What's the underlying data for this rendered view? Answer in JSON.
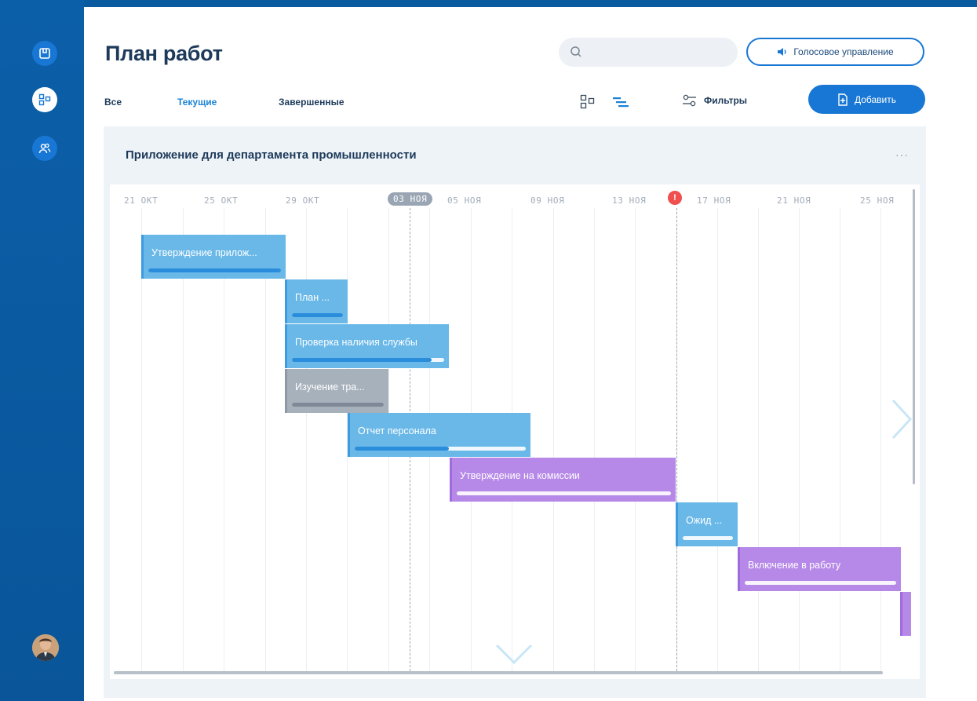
{
  "page": {
    "title": "План работ"
  },
  "search": {
    "placeholder": ""
  },
  "header": {
    "voice_label": "Голосовое управление"
  },
  "tabs": [
    {
      "label": "Все",
      "active": false
    },
    {
      "label": "Текущие",
      "active": true
    },
    {
      "label": "Завершенные",
      "active": false
    }
  ],
  "toolbar": {
    "filters_label": "Фильтры",
    "add_label": "Добавить"
  },
  "project": {
    "title": "Приложение для департамента промышленности",
    "menu": "···"
  },
  "gantt": {
    "dates": [
      "21 ОКТ",
      "25 ОКТ",
      "29 ОКТ",
      "03 НОЯ",
      "05 НОЯ",
      "09 НОЯ",
      "13 НОЯ",
      "17 НОЯ",
      "21 НОЯ",
      "25 НОЯ"
    ],
    "today": "03 НОЯ",
    "alert_mark": "!",
    "tasks": [
      {
        "label": "Утверждение прилож...",
        "color": "blue",
        "progress": 1.0
      },
      {
        "label": "План ...",
        "color": "blue",
        "progress": 1.0
      },
      {
        "label": "Проверка наличия службы",
        "color": "blue",
        "progress": 0.92
      },
      {
        "label": "Изучение тра...",
        "color": "gray",
        "progress": 1.0
      },
      {
        "label": "Отчет персонала",
        "color": "blue",
        "progress": 0.55
      },
      {
        "label": "Утверждение на комиссии",
        "color": "purple",
        "progress": 0.0
      },
      {
        "label": "Ожид ...",
        "color": "blue",
        "progress": 0.0
      },
      {
        "label": "Включение в работу",
        "color": "purple",
        "progress": 0.0
      },
      {
        "label": "",
        "color": "purple",
        "progress": 0.0
      }
    ]
  },
  "colors": {
    "accent": "#1877d4",
    "sidebar": "#0a5aa0",
    "alert": "#ef4f4f",
    "task_blue": "#69b8e8",
    "task_purple": "#b689e8",
    "task_gray": "#a7b1bc"
  }
}
